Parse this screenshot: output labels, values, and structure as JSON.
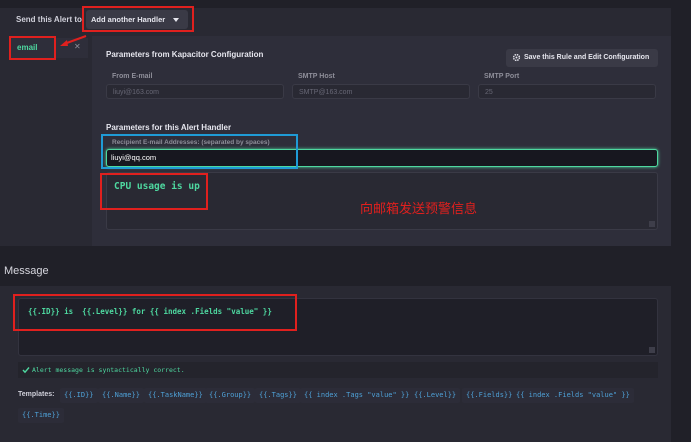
{
  "send_to": {
    "label": "Send this Alert to:",
    "dropdown_label": "Add another Handler"
  },
  "handler_tab": {
    "label": "email",
    "close_glyph": "✕"
  },
  "kapacitor": {
    "heading": "Parameters from Kapacitor Configuration",
    "save_button": "Save this Rule and Edit Configuration",
    "fields": [
      {
        "label": "From E-mail",
        "value": "liuyi@163.com"
      },
      {
        "label": "SMTP Host",
        "value": "SMTP@163.com"
      },
      {
        "label": "SMTP Port",
        "value": "25"
      }
    ]
  },
  "alert_handler": {
    "heading": "Parameters for this Alert Handler",
    "recipient_label": "Recipient E-mail Addresses: (separated by spaces)",
    "recipient_value": "liuyi@qq.com",
    "body_text": "CPU usage is up"
  },
  "annotation": {
    "text": "向邮箱发送预警信息",
    "color": "#e0201e"
  },
  "message": {
    "section_title": "Message",
    "text": "{{.ID}} is  {{.Level}} for {{ index .Fields \"value\" }}",
    "validation": "Alert message is syntactically correct.",
    "templates_label": "Templates:",
    "templates": [
      "{{.ID}}",
      "{{.Name}}",
      "{{.TaskName}}",
      "{{.Group}}",
      "{{.Tags}}",
      "{{ index .Tags \"value\" }}",
      "{{.Level}}",
      "{{.Fields}}",
      "{{ index .Fields \"value\" }}",
      "{{.Time}}"
    ]
  },
  "colors": {
    "accent": "#4ea0d6",
    "success": "#4ed8a0",
    "highlight_box": "#e0201e",
    "focus_box": "#1f9bd6"
  }
}
